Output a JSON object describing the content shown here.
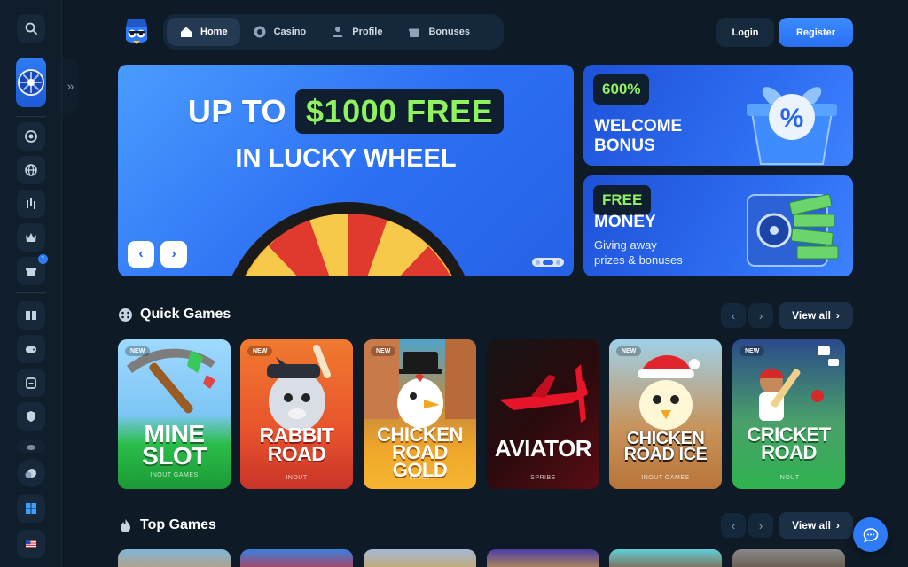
{
  "nav": {
    "home": "Home",
    "casino": "Casino",
    "profile": "Profile",
    "bonuses": "Bonuses"
  },
  "auth": {
    "login": "Login",
    "register": "Register"
  },
  "sidebar": {
    "bonus_badge": "1"
  },
  "hero": {
    "line1_prefix": "UP TO",
    "line1_highlight": "$1000 FREE",
    "line2": "IN LUCKY WHEEL",
    "prev": "‹",
    "next": "›"
  },
  "promos": [
    {
      "tag": "600%",
      "title_1": "WELCOME",
      "title_2": "BONUS"
    },
    {
      "tag": "FREE",
      "title_1": "MONEY",
      "subtitle_1": "Giving away",
      "subtitle_2": "prizes & bonuses"
    }
  ],
  "quick_games": {
    "title": "Quick Games",
    "view_all": "View all",
    "games": [
      {
        "line1": "MINE",
        "line2": "SLOT",
        "provider": "INOUT GAMES",
        "new": "NEW"
      },
      {
        "line1": "RABBIT",
        "line2": "ROAD",
        "provider": "INOUT",
        "new": "NEW"
      },
      {
        "line1": "CHICKEN",
        "line2": "ROAD GOLD",
        "provider": "INOUT",
        "new": "NEW"
      },
      {
        "line1": "AVIATOR",
        "line2": "",
        "provider": "SPRIBE",
        "new": ""
      },
      {
        "line1": "CHICKEN",
        "line2": "ROAD ICE",
        "provider": "INOUT GAMES",
        "new": "NEW"
      },
      {
        "line1": "CRICKET",
        "line2": "ROAD",
        "provider": "INOUT",
        "new": "NEW"
      }
    ]
  },
  "top_games": {
    "title": "Top Games",
    "view_all": "View all"
  },
  "colors": {
    "accent": "#2f7bf5",
    "highlight_green": "#8ef35f",
    "background": "#0e1a26"
  }
}
